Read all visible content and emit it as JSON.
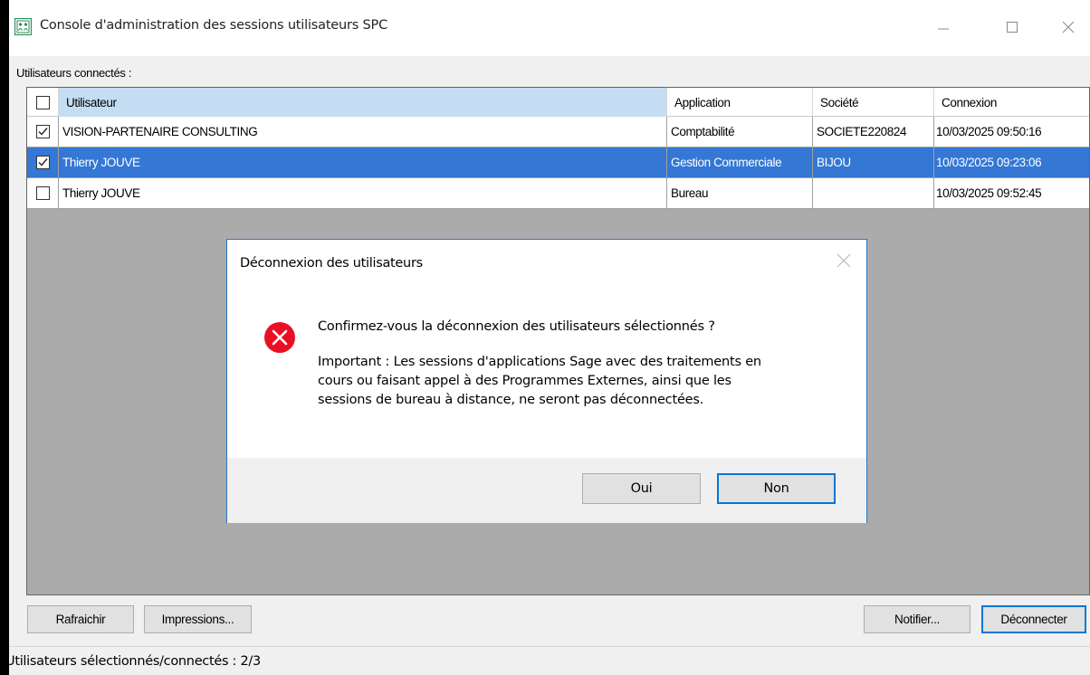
{
  "window": {
    "title": "Console d'administration des sessions utilisateurs SPC"
  },
  "users_label": "Utilisateurs connectés :",
  "grid": {
    "headers": {
      "user": "Utilisateur",
      "application": "Application",
      "societe": "Société",
      "connexion": "Connexion"
    },
    "rows": [
      {
        "checked": true,
        "selected": false,
        "user": "VISION-PARTENAIRE CONSULTING",
        "application": "Comptabilité",
        "societe": "SOCIETE220824",
        "connexion": "10/03/2025 09:50:16"
      },
      {
        "checked": true,
        "selected": true,
        "user": "Thierry JOUVE",
        "application": "Gestion Commerciale",
        "societe": "BIJOU",
        "connexion": "10/03/2025 09:23:06"
      },
      {
        "checked": false,
        "selected": false,
        "user": "Thierry JOUVE",
        "application": "Bureau",
        "societe": "",
        "connexion": "10/03/2025 09:52:45"
      }
    ]
  },
  "dialog": {
    "title": "Déconnexion des utilisateurs",
    "question": "Confirmez-vous la déconnexion des utilisateurs sélectionnés ?",
    "important_lines": [
      "Important : Les sessions d'applications Sage avec des traitements en",
      "cours ou faisant appel à des Programmes Externes, ainsi que les",
      "sessions de bureau à distance, ne seront pas déconnectées."
    ],
    "yes_label": "Oui",
    "no_label": "Non",
    "icon": "error-icon"
  },
  "buttons": {
    "refresh": "Rafraichir",
    "print": "Impressions...",
    "notify": "Notifier...",
    "disconnect": "Déconnecter"
  },
  "status": {
    "text": "Utilisateurs sélectionnés/connectés : 2/3"
  },
  "colors": {
    "selection": "#3477d4",
    "header_highlight": "#c4ddf3",
    "error_red": "#e81123",
    "dialog_border": "#2b76c9",
    "app_icon_green": "#2e8b57"
  }
}
